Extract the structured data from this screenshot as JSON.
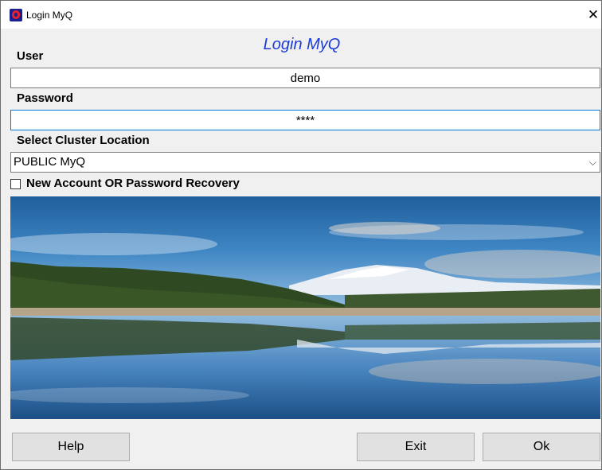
{
  "window": {
    "title": "Login MyQ",
    "app_icon": "myq-logo-icon",
    "close_icon": "close-icon",
    "close_glyph": "✕"
  },
  "form": {
    "heading": "Login MyQ",
    "user_label": "User",
    "user_value": "demo",
    "password_label": "Password",
    "password_value": "****",
    "cluster_label": "Select Cluster Location",
    "cluster_value": "PUBLIC MyQ",
    "cluster_chevron": "⌵",
    "checkbox_label": "New Account OR Password Recovery",
    "checkbox_checked": false
  },
  "buttons": {
    "help": "Help",
    "exit": "Exit",
    "ok": "Ok"
  },
  "colors": {
    "heading": "#1a3bd6",
    "focus_border": "#0078d7",
    "button_face": "#e1e1e1"
  }
}
